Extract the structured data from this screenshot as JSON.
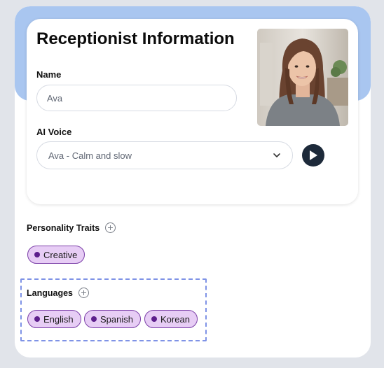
{
  "header": {
    "title": "Receptionist Information"
  },
  "name_field": {
    "label": "Name",
    "value": "Ava"
  },
  "voice_field": {
    "label": "AI Voice",
    "selected": "Ava - Calm and slow"
  },
  "personality": {
    "label": "Personality Traits",
    "tags": [
      "Creative"
    ]
  },
  "languages": {
    "label": "Languages",
    "tags": [
      "English",
      "Spanish",
      "Korean"
    ]
  },
  "colors": {
    "accent_band": "#a9c6f0",
    "tag_bg": "#e7cdf5",
    "tag_border": "#7b3fa8",
    "play_button": "#1d2a3a"
  },
  "icons": {
    "play": "play-icon",
    "add": "plus-circle-icon",
    "dropdown": "chevron-down-icon"
  }
}
